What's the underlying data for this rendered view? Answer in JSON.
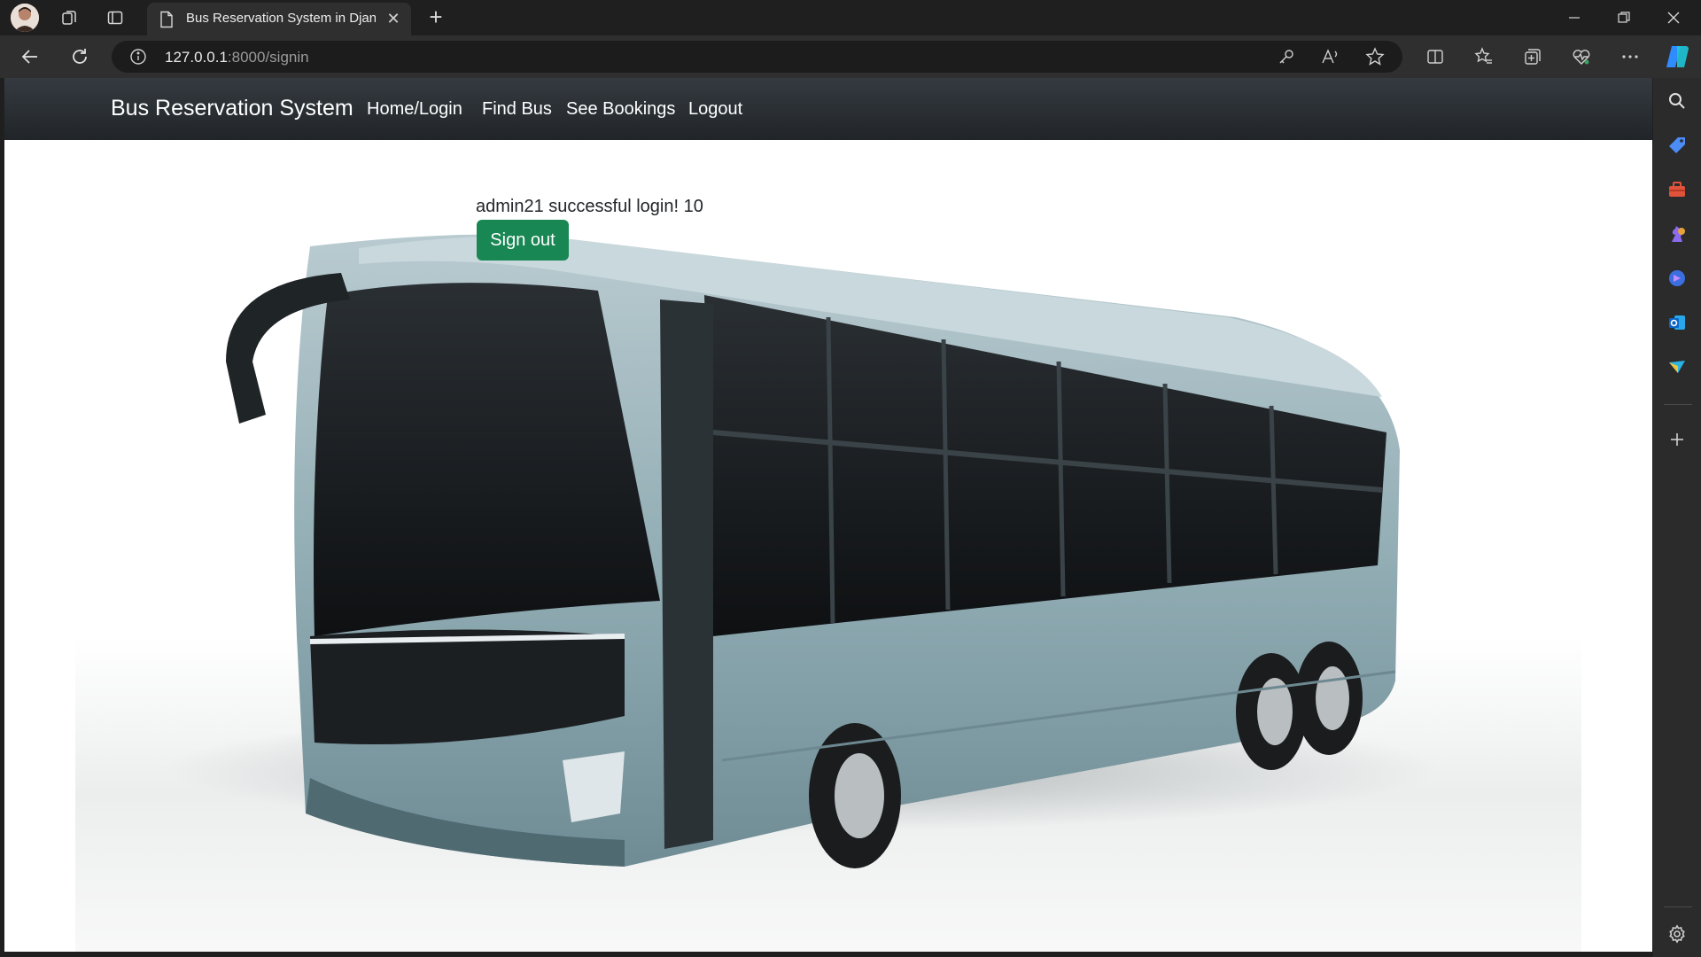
{
  "browser": {
    "tab_title": "Bus Reservation System in Djang",
    "url_host": "127.0.0.1",
    "url_path": ":8000/signin"
  },
  "page": {
    "brand": "Bus Reservation System",
    "nav": [
      {
        "label": "Home/Login"
      },
      {
        "label": "Find Bus"
      },
      {
        "label": "See Bookings"
      },
      {
        "label": "Logout"
      }
    ],
    "message": "admin21 successful login! 10",
    "signout_label": "Sign out"
  },
  "colors": {
    "navbar": "#212529",
    "button": "#198754",
    "bus_body": "#8fa9b0"
  }
}
